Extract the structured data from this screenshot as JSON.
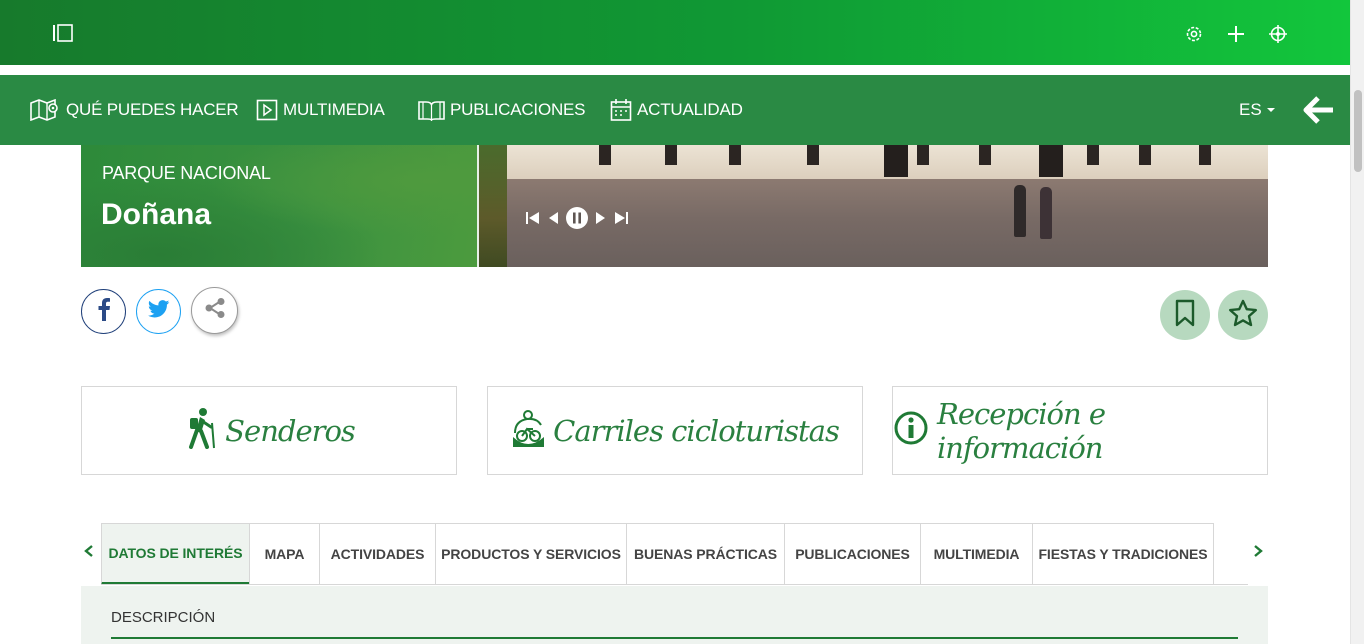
{
  "topbar": {
    "icons": [
      "sidebar-toggle-icon",
      "gear-icon",
      "plus-icon",
      "crosshair-icon"
    ]
  },
  "nav": {
    "items": [
      {
        "label": "QUÉ PUEDES HACER",
        "icon": "map-pin-icon"
      },
      {
        "label": "MULTIMEDIA",
        "icon": "play-icon"
      },
      {
        "label": "PUBLICACIONES",
        "icon": "book-icon"
      },
      {
        "label": "ACTUALIDAD",
        "icon": "calendar-icon"
      }
    ],
    "language": "ES",
    "back_icon": "arrow-left-icon"
  },
  "hero": {
    "park_type": "PARQUE NACIONAL",
    "park_name": "Doñana",
    "player_controls": [
      "first-icon",
      "prev-icon",
      "pause-icon",
      "next-icon",
      "last-icon"
    ]
  },
  "social": [
    "facebook-icon",
    "twitter-icon",
    "share-icon"
  ],
  "actions": [
    "bookmark-icon",
    "star-icon"
  ],
  "cards": [
    {
      "label": "Senderos",
      "icon": "hiker-icon"
    },
    {
      "label": "Carriles cicloturistas",
      "icon": "bicycle-icon"
    },
    {
      "label": "Recepción e información",
      "icon": "info-icon"
    }
  ],
  "tabs": {
    "items": [
      {
        "label": "DATOS DE INTERÉS",
        "active": true
      },
      {
        "label": "MAPA",
        "active": false
      },
      {
        "label": "ACTIVIDADES",
        "active": false
      },
      {
        "label": "PRODUCTOS Y SERVICIOS",
        "active": false
      },
      {
        "label": "BUENAS PRÁCTICAS",
        "active": false
      },
      {
        "label": "PUBLICACIONES",
        "active": false
      },
      {
        "label": "MULTIMEDIA",
        "active": false
      },
      {
        "label": "FIESTAS Y TRADICIONES",
        "active": false
      }
    ]
  },
  "content": {
    "section_title": "DESCRIPCIÓN"
  },
  "colors": {
    "primary_green": "#2a8a44",
    "accent_green": "#1f7a35",
    "soft_green": "#b7d9bf"
  }
}
